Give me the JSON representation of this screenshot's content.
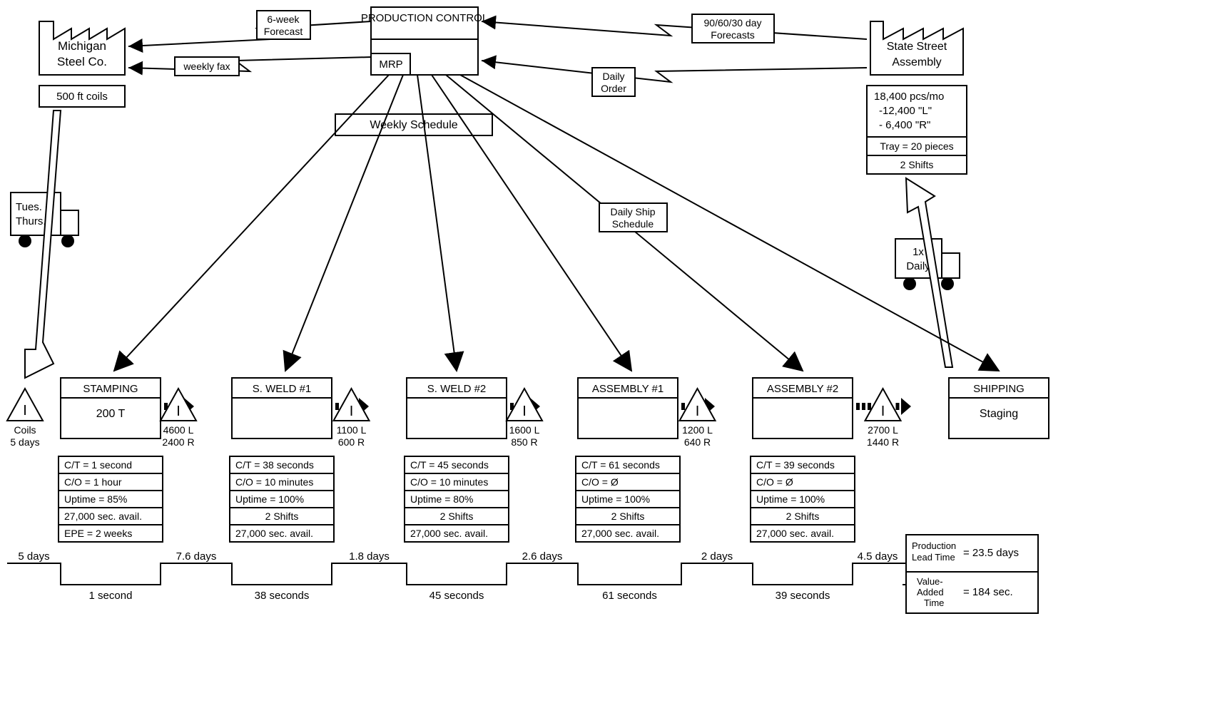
{
  "production_control": {
    "title": "PRODUCTION CONTROL",
    "mrp": "MRP"
  },
  "supplier": {
    "name1": "Michigan",
    "name2": "Steel Co.",
    "coils": "500 ft coils",
    "ship": "Tues. +",
    "ship2": "Thurs."
  },
  "customer": {
    "name1": "State Street",
    "name2": "Assembly",
    "d1": "18,400 pcs/mo",
    "d2": "-12,400  \"L\"",
    "d3": "- 6,400  \"R\"",
    "d4": "Tray = 20 pieces",
    "d5": "2 Shifts",
    "ship": "1x",
    "ship2": "Daily"
  },
  "info": {
    "forecast6": "6-week",
    "forecast6b": "Forecast",
    "forecast9": "90/60/30 day",
    "forecast9b": "Forecasts",
    "weeklyfax": "weekly fax",
    "dailyorder": "Daily",
    "dailyorder2": "Order",
    "weeklyschedule": "Weekly Schedule",
    "dailyship": "Daily Ship",
    "dailyship2": "Schedule"
  },
  "inv0": {
    "l1": "Coils",
    "l2": "5 days"
  },
  "proc": [
    {
      "name": "STAMPING",
      "sub": "200 T",
      "d": [
        "C/T = 1 second",
        "C/O =  1 hour",
        "Uptime = 85%",
        "27,000 sec. avail.",
        "EPE = 2 weeks"
      ]
    },
    {
      "name": "S. WELD #1",
      "sub": "",
      "d": [
        "C/T = 38 seconds",
        "C/O =  10 minutes",
        "Uptime = 100%",
        "2 Shifts",
        "27,000 sec. avail."
      ]
    },
    {
      "name": "S. WELD #2",
      "sub": "",
      "d": [
        "C/T = 45 seconds",
        "C/O =  10 minutes",
        "Uptime = 80%",
        "2 Shifts",
        "27,000 sec. avail."
      ]
    },
    {
      "name": "ASSEMBLY #1",
      "sub": "",
      "d": [
        "C/T = 61 seconds",
        "C/O = Ø",
        "Uptime = 100%",
        "2 Shifts",
        "27,000 sec. avail."
      ]
    },
    {
      "name": "ASSEMBLY #2",
      "sub": "",
      "d": [
        "C/T = 39 seconds",
        "C/O =  Ø",
        "Uptime = 100%",
        "2 Shifts",
        "27,000 sec. avail."
      ]
    },
    {
      "name": "SHIPPING",
      "sub": "Staging",
      "d": []
    }
  ],
  "inv": [
    {
      "l": "4600 L",
      "r": "2400 R"
    },
    {
      "l": "1100 L",
      "r": "600 R"
    },
    {
      "l": "1600 L",
      "r": "850 R"
    },
    {
      "l": "1200 L",
      "r": "640 R"
    },
    {
      "l": "2700 L",
      "r": "1440 R"
    }
  ],
  "timeline": {
    "top": [
      "5 days",
      "7.6 days",
      "1.8 days",
      "2.6 days",
      "2 days",
      "4.5 days"
    ],
    "bot": [
      "1 second",
      "38 seconds",
      "45 seconds",
      "61 seconds",
      "39 seconds"
    ]
  },
  "totals": {
    "lt1": "Production",
    "lt2": "Lead Time",
    "lt3": "= 23.5 days",
    "va1": "Value-",
    "va2": "Added",
    "va3": "Time",
    "va4": "= 184 sec."
  }
}
